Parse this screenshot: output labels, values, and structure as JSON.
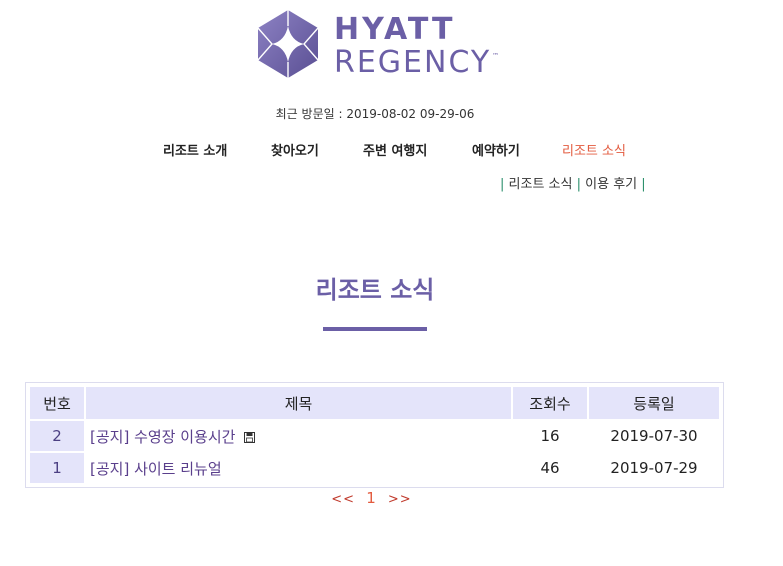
{
  "brand": {
    "name_line1": "HYATT",
    "name_line2": "REGENCY",
    "trademark": "™",
    "color": "#6b5fa6"
  },
  "last_visit": "최근 방문일 : 2019-08-02 09-29-06",
  "nav": {
    "items": [
      {
        "label": "리조트 소개"
      },
      {
        "label": "찾아오기"
      },
      {
        "label": "주변 여행지"
      },
      {
        "label": "예약하기"
      },
      {
        "label": "리조트 소식",
        "active": true
      }
    ],
    "active_color": "#e35b3f"
  },
  "subnav": {
    "separator": "|",
    "items": [
      {
        "label": "리조트 소식"
      },
      {
        "label": "이용 후기"
      }
    ]
  },
  "page_title": "리조트 소식",
  "board": {
    "headers": {
      "num": "번호",
      "subject": "제목",
      "views": "조회수",
      "date": "등록일"
    },
    "rows": [
      {
        "num": "2",
        "subject": "[공지] 수영장 이용시간",
        "has_attachment": true,
        "attachment_icon": "floppy-disk-icon",
        "views": "16",
        "date": "2019-07-30"
      },
      {
        "num": "1",
        "subject": "[공지] 사이트 리뉴얼",
        "has_attachment": false,
        "views": "46",
        "date": "2019-07-29"
      }
    ]
  },
  "pagination": {
    "prev": "<<",
    "current": "1",
    "next": ">>"
  }
}
